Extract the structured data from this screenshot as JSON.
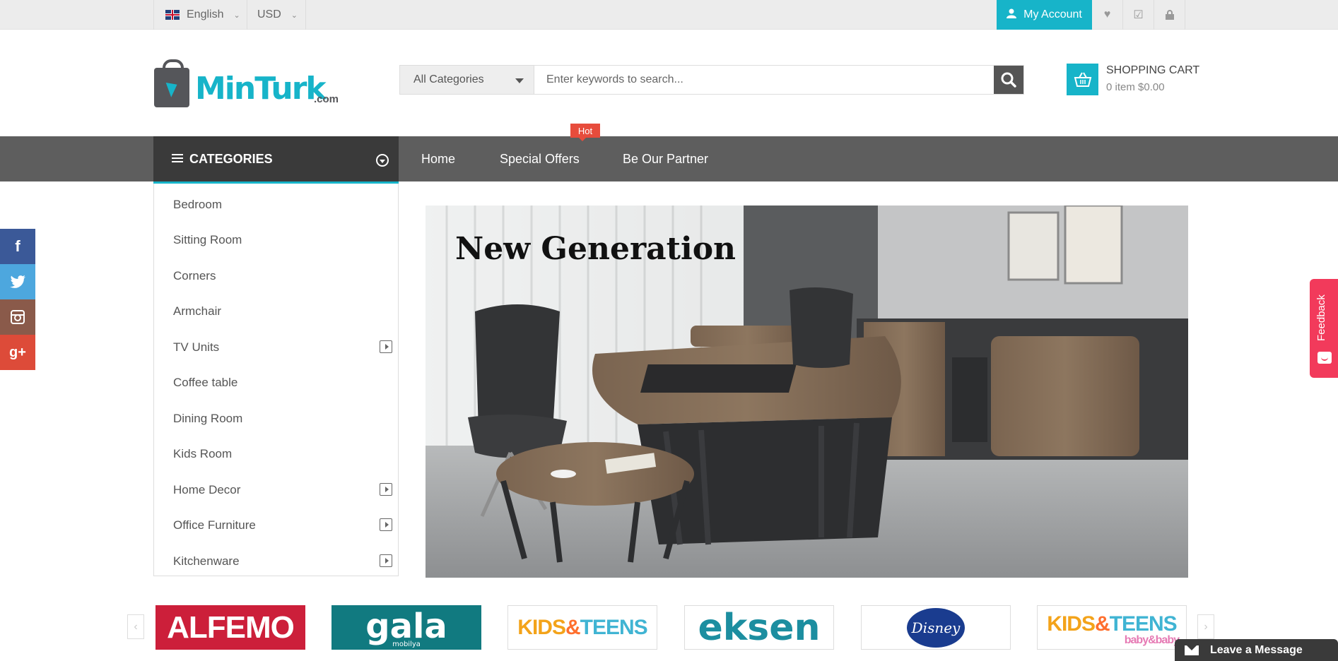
{
  "topbar": {
    "language": "English",
    "currency": "USD",
    "account_label": "My Account",
    "icons": [
      "heart-icon",
      "checklist-icon",
      "lock-icon"
    ]
  },
  "brand": {
    "logo_text": "MinTurk",
    "logo_suffix": ".com"
  },
  "search": {
    "category": "All Categories",
    "placeholder": "Enter keywords to search..."
  },
  "cart": {
    "title": "SHOPPING CART",
    "summary": "0 item $0.00"
  },
  "nav": {
    "categories_label": "CATEGORIES",
    "links": [
      "Home",
      "Special Offers",
      "Be Our Partner"
    ],
    "hot_badge": "Hot"
  },
  "sidebar": {
    "items": [
      {
        "label": "Bedroom",
        "has_sub": false
      },
      {
        "label": "Sitting Room",
        "has_sub": false
      },
      {
        "label": "Corners",
        "has_sub": false
      },
      {
        "label": "Armchair",
        "has_sub": false
      },
      {
        "label": "TV Units",
        "has_sub": true
      },
      {
        "label": "Coffee table",
        "has_sub": false
      },
      {
        "label": "Dining Room",
        "has_sub": false
      },
      {
        "label": "Kids Room",
        "has_sub": false
      },
      {
        "label": "Home Decor",
        "has_sub": true
      },
      {
        "label": "Office Furniture",
        "has_sub": true
      },
      {
        "label": "Kitchenware",
        "has_sub": true
      }
    ]
  },
  "banner": {
    "headline": "New Generation"
  },
  "social": [
    "facebook",
    "twitter",
    "instagram",
    "google-plus"
  ],
  "feedback": {
    "label": "Feedback"
  },
  "brands": [
    "ALFEMO",
    "gala",
    "KIDS&TEENS",
    "eksen",
    "Disney",
    "KIDS&TEENS baby&baby"
  ],
  "brand_text": {
    "alfemo": "ALFEMO",
    "gala": "gala",
    "gala_sub": "mobilya",
    "kids_1": "KIDS",
    "kids_amp": "&",
    "kids_2": "TEENS",
    "eksen": "eksen",
    "disney": "Disney",
    "babybaby": "baby&baby"
  },
  "chat": {
    "label": "Leave a Message"
  },
  "colors": {
    "accent": "#17b4c9",
    "nav": "#5e5e5e",
    "hot": "#e74c3c",
    "feedback": "#f23a5b"
  }
}
